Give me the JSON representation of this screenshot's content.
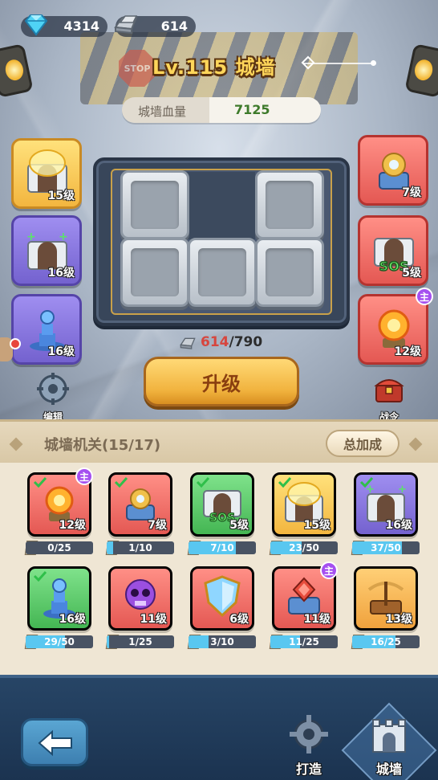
{
  "currency": {
    "gems": "4314",
    "iron": "614"
  },
  "header": {
    "title": "Lv.115 城墙",
    "stop_sign": "STOP"
  },
  "wall_hp": {
    "label": "城墙血量",
    "value": "7125"
  },
  "capacity": {
    "current": "614",
    "separator": "/",
    "max": "790"
  },
  "upgrade_button": "升级",
  "left_cards": [
    {
      "level": "15级",
      "color": "gold",
      "icon": "gold-gate-icon"
    },
    {
      "level": "16级",
      "color": "purple",
      "icon": "heal-gate-icon"
    },
    {
      "level": "16级",
      "color": "purple",
      "icon": "blue-tower-icon"
    }
  ],
  "right_cards": [
    {
      "level": "7级",
      "color": "red",
      "icon": "cannon-turret-icon"
    },
    {
      "level": "5级",
      "color": "red",
      "icon": "sos-gate-icon"
    },
    {
      "level": "12级",
      "color": "red",
      "icon": "fire-orb-icon",
      "badge": "主"
    }
  ],
  "tools": {
    "edit_label": "编辑",
    "battle_pass_label": "战令"
  },
  "panel": {
    "title": "城墙机关(15/17)",
    "total_bonus_button": "总加成",
    "items": [
      {
        "level": "12级",
        "progress": "0/25",
        "fill": 0.0,
        "color": "red",
        "checked": true,
        "badge": "主",
        "icon": "fire-orb-icon"
      },
      {
        "level": "7级",
        "progress": "1/10",
        "fill": 0.1,
        "color": "red",
        "checked": true,
        "icon": "cannon-turret-icon"
      },
      {
        "level": "5级",
        "progress": "7/10",
        "fill": 0.7,
        "color": "green",
        "checked": true,
        "icon": "sos-gate-icon"
      },
      {
        "level": "15级",
        "progress": "23/50",
        "fill": 0.46,
        "color": "gold",
        "checked": true,
        "icon": "gold-gate-icon"
      },
      {
        "level": "16级",
        "progress": "37/50",
        "fill": 0.74,
        "color": "purple",
        "checked": true,
        "icon": "heal-gate-icon"
      },
      {
        "level": "16级",
        "progress": "29/50",
        "fill": 0.58,
        "color": "green",
        "checked": true,
        "icon": "blue-tower-icon"
      },
      {
        "level": "11级",
        "progress": "1/25",
        "fill": 0.04,
        "color": "red",
        "checked": false,
        "icon": "purple-skull-icon"
      },
      {
        "level": "6级",
        "progress": "3/10",
        "fill": 0.3,
        "color": "red",
        "checked": false,
        "icon": "ice-shield-icon"
      },
      {
        "level": "11级",
        "progress": "11/25",
        "fill": 0.44,
        "color": "red",
        "checked": false,
        "badge": "主",
        "icon": "crystal-turret-icon"
      },
      {
        "level": "13级",
        "progress": "16/25",
        "fill": 0.64,
        "color": "orange",
        "checked": false,
        "icon": "crossbow-icon"
      }
    ]
  },
  "nav": {
    "forge_label": "打造",
    "wall_label": "城墙"
  },
  "colors": {
    "gold": "#f3b63f",
    "purple": "#7462cf",
    "red": "#e45853",
    "green": "#44b653",
    "orange": "#f0a23d",
    "progress_fill": "#59c7f0",
    "title_text": "#ffd65a",
    "hp_value": "#3d7a2a",
    "capacity_current": "#d7463e"
  }
}
